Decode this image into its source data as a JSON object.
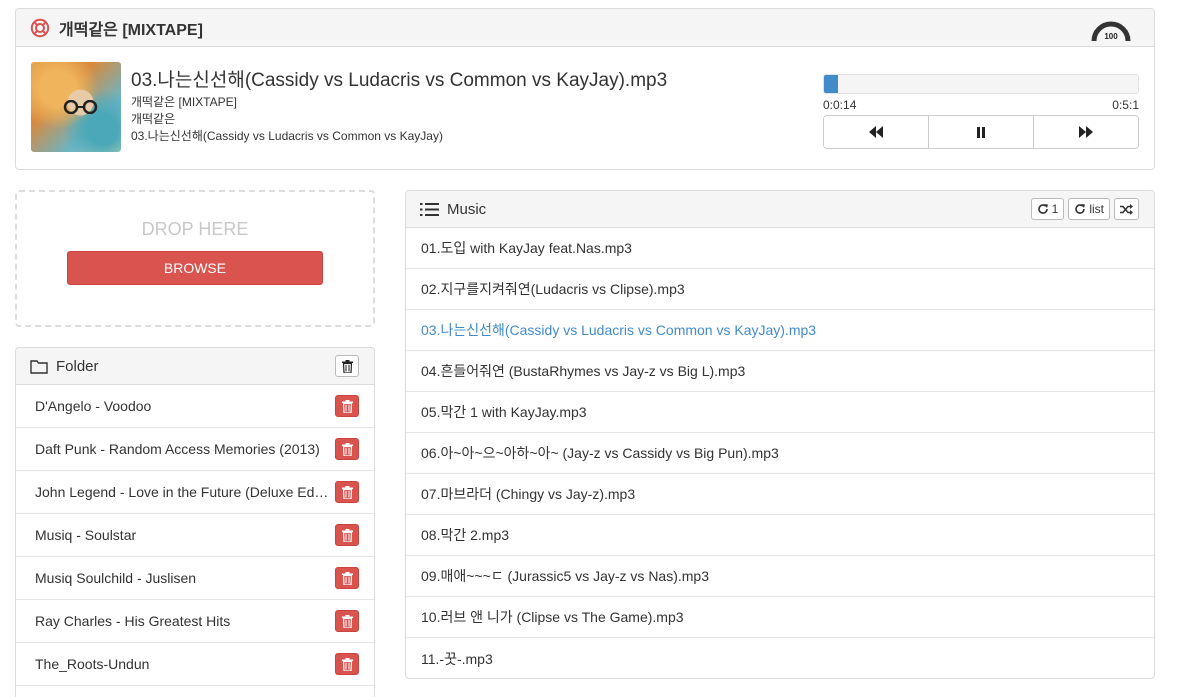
{
  "player": {
    "title": "개떡같은 [MIXTAPE]",
    "volume": "100",
    "track_title": "03.나는신선해(Cassidy vs Ludacris vs Common vs KayJay).mp3",
    "album": "개떡같은 [MIXTAPE]",
    "artist": "개떡같은",
    "song": "03.나는신선해(Cassidy vs Ludacris vs Common vs KayJay)",
    "elapsed": "0:0:14",
    "duration": "0:5:1",
    "progress_fraction": 0.046,
    "accent_color": "#428bca"
  },
  "dropzone": {
    "text": "DROP HERE",
    "browse_label": "BROWSE"
  },
  "folder": {
    "title": "Folder",
    "items": [
      "D'Angelo - Voodoo",
      "Daft Punk - Random Access Memories (2013)",
      "John Legend - Love in the Future (Deluxe Edition)",
      "Musiq - Soulstar",
      "Musiq Soulchild - Juslisen",
      "Ray Charles - His Greatest Hits",
      "The_Roots-Undun"
    ],
    "delete_color": "#d9534f"
  },
  "music": {
    "title": "Music",
    "repeat_one_label": "1",
    "repeat_list_label": "list",
    "active_index": 2,
    "songs": [
      "01.도입 with KayJay feat.Nas.mp3",
      "02.지구를지켜줘연(Ludacris vs Clipse).mp3",
      "03.나는신선해(Cassidy vs Ludacris vs Common vs KayJay).mp3",
      "04.흔들어줘연 (BustaRhymes vs Jay-z vs Big L).mp3",
      "05.막간 1 with KayJay.mp3",
      "06.아~아~으~아하~아~ (Jay-z vs Cassidy vs Big Pun).mp3",
      "07.마브라더 (Chingy vs Jay-z).mp3",
      "08.막간 2.mp3",
      "09.매애~~~ㄷ (Jurassic5 vs Jay-z vs Nas).mp3",
      "10.러브 앤 니가 (Clipse vs The Game).mp3",
      "11.-꿋-.mp3"
    ]
  }
}
